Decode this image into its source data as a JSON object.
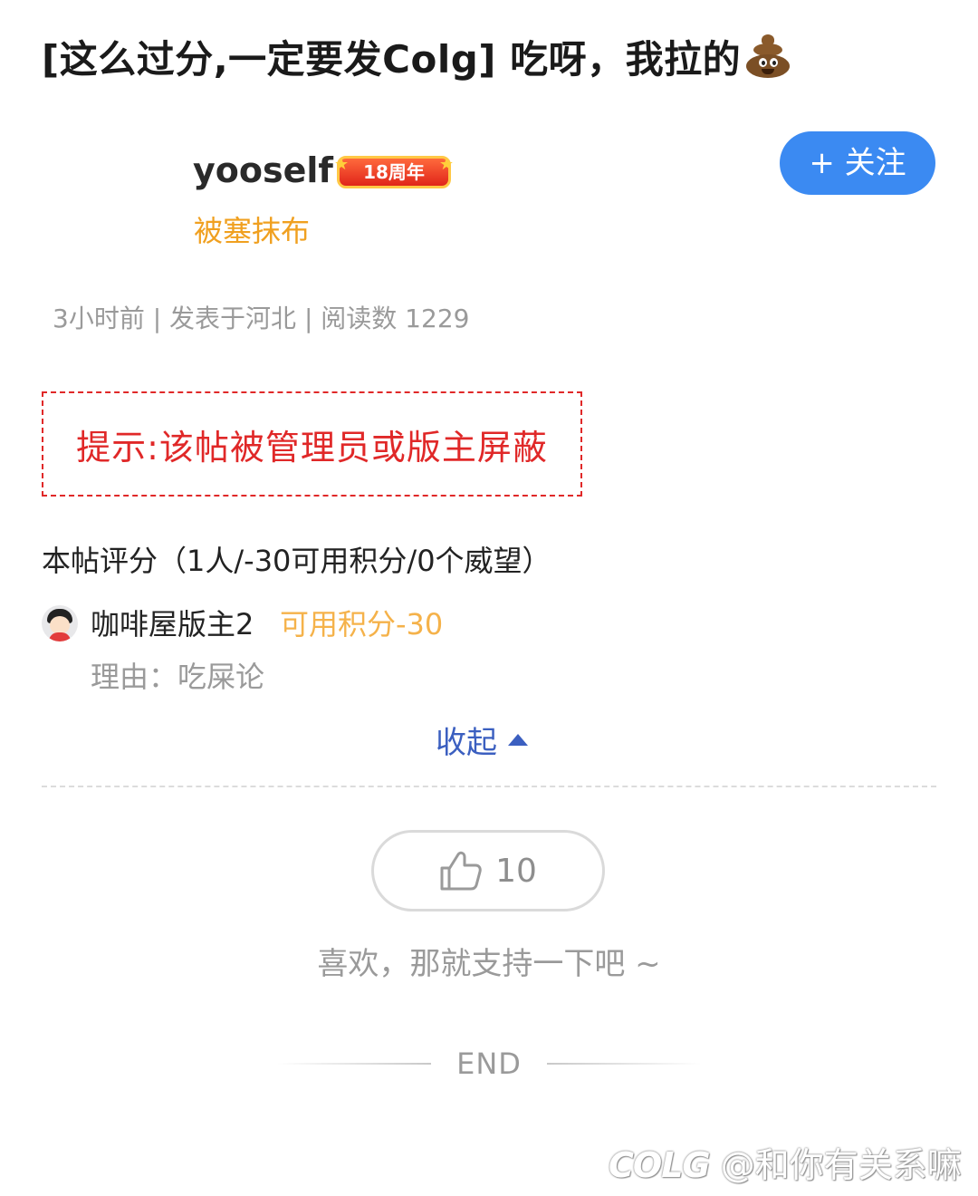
{
  "post": {
    "title": "[这么过分,一定要发Colg] 吃呀，我拉的",
    "title_emoji": "poop"
  },
  "author": {
    "name": "yooself",
    "badge": "18周年",
    "title": "被塞抹布",
    "follow_label": "+ 关注"
  },
  "meta": {
    "text": "3小时前 | 发表于河北 | 阅读数 1229"
  },
  "notice": {
    "text": "提示:该帖被管理员或版主屏蔽",
    "color": "#e02828"
  },
  "rating": {
    "summary": "本帖评分（1人/-30可用积分/0个威望）",
    "entries": [
      {
        "rater": "咖啡屋版主2",
        "score": "可用积分-30",
        "reason": "理由：吃屎论"
      }
    ],
    "collapse_label": "收起"
  },
  "like": {
    "count": "10",
    "prompt": "喜欢，那就支持一下吧 ~"
  },
  "footer": {
    "end": "END",
    "watermark_logo": "COLG",
    "watermark_text": "@和你有关系嘛"
  },
  "colors": {
    "accent_blue": "#3b8af2",
    "author_title": "#f0a020",
    "score": "#f5b24a",
    "link": "#3b5fc0"
  }
}
